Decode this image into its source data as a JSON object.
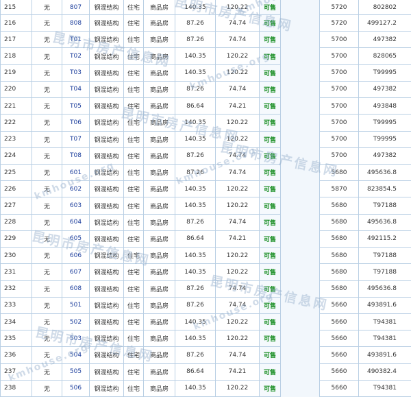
{
  "table": {
    "rows": [
      [
        "215",
        "无",
        "807",
        "钢混结构",
        "住宅",
        "商品房",
        "140.35",
        "120.22",
        "可售",
        "5720",
        "802802"
      ],
      [
        "216",
        "无",
        "808",
        "钢混结构",
        "住宅",
        "商品房",
        "87.26",
        "74.74",
        "可售",
        "5720",
        "499127.2"
      ],
      [
        "217",
        "无",
        "T01",
        "钢混结构",
        "住宅",
        "商品房",
        "87.26",
        "74.74",
        "可售",
        "5700",
        "497382"
      ],
      [
        "218",
        "无",
        "T02",
        "钢混结构",
        "住宅",
        "商品房",
        "140.35",
        "120.22",
        "可售",
        "5700",
        "828065"
      ],
      [
        "219",
        "无",
        "T03",
        "钢混结构",
        "住宅",
        "商品房",
        "140.35",
        "120.22",
        "可售",
        "5700",
        "T99995"
      ],
      [
        "220",
        "无",
        "T04",
        "钢混结构",
        "住宅",
        "商品房",
        "87.26",
        "74.74",
        "可售",
        "5700",
        "497382"
      ],
      [
        "221",
        "无",
        "T05",
        "钢混结构",
        "住宅",
        "商品房",
        "86.64",
        "74.21",
        "可售",
        "5700",
        "493848"
      ],
      [
        "222",
        "无",
        "T06",
        "钢混结构",
        "住宅",
        "商品房",
        "140.35",
        "120.22",
        "可售",
        "5700",
        "T99995"
      ],
      [
        "223",
        "无",
        "T07",
        "钢混结构",
        "住宅",
        "商品房",
        "140.35",
        "120.22",
        "可售",
        "5700",
        "T99995"
      ],
      [
        "224",
        "无",
        "T08",
        "钢混结构",
        "住宅",
        "商品房",
        "87.26",
        "74.74",
        "可售",
        "5700",
        "497382"
      ],
      [
        "225",
        "无",
        "601",
        "钢混结构",
        "住宅",
        "商品房",
        "87.26",
        "74.74",
        "可售",
        "5680",
        "495636.8"
      ],
      [
        "226",
        "无",
        "602",
        "钢混结构",
        "住宅",
        "商品房",
        "140.35",
        "120.22",
        "可售",
        "5870",
        "823854.5"
      ],
      [
        "227",
        "无",
        "603",
        "钢混结构",
        "住宅",
        "商品房",
        "140.35",
        "120.22",
        "可售",
        "5680",
        "T97188"
      ],
      [
        "228",
        "无",
        "604",
        "钢混结构",
        "住宅",
        "商品房",
        "87.26",
        "74.74",
        "可售",
        "5680",
        "495636.8"
      ],
      [
        "229",
        "无",
        "605",
        "钢混结构",
        "住宅",
        "商品房",
        "86.64",
        "74.21",
        "可售",
        "5680",
        "492115.2"
      ],
      [
        "230",
        "无",
        "606",
        "钢混结构",
        "住宅",
        "商品房",
        "140.35",
        "120.22",
        "可售",
        "5680",
        "T97188"
      ],
      [
        "231",
        "无",
        "607",
        "钢混结构",
        "住宅",
        "商品房",
        "140.35",
        "120.22",
        "可售",
        "5680",
        "T97188"
      ],
      [
        "232",
        "无",
        "608",
        "钢混结构",
        "住宅",
        "商品房",
        "87.26",
        "74.74",
        "可售",
        "5680",
        "495636.8"
      ],
      [
        "233",
        "无",
        "501",
        "钢混结构",
        "住宅",
        "商品房",
        "87.26",
        "74.74",
        "可售",
        "5660",
        "493891.6"
      ],
      [
        "234",
        "无",
        "502",
        "钢混结构",
        "住宅",
        "商品房",
        "140.35",
        "120.22",
        "可售",
        "5660",
        "T94381"
      ],
      [
        "235",
        "无",
        "503",
        "钢混结构",
        "住宅",
        "商品房",
        "140.35",
        "120.22",
        "可售",
        "5660",
        "T94381"
      ],
      [
        "236",
        "无",
        "504",
        "钢混结构",
        "住宅",
        "商品房",
        "87.26",
        "74.74",
        "可售",
        "5660",
        "493891.6"
      ],
      [
        "237",
        "无",
        "505",
        "钢混结构",
        "住宅",
        "商品房",
        "86.64",
        "74.21",
        "可售",
        "5660",
        "490382.4"
      ],
      [
        "238",
        "无",
        "506",
        "钢混结构",
        "住宅",
        "商品房",
        "140.35",
        "120.22",
        "可售",
        "5660",
        "T94381"
      ]
    ]
  },
  "watermark": {
    "site_name": "昆明市房产信息网",
    "site_url": "kmhouse.org"
  },
  "colors": {
    "border": "#b9cfe4",
    "room_number": "#1a3c9b",
    "status_available": "#118a1b",
    "watermark": "#96afcd"
  }
}
